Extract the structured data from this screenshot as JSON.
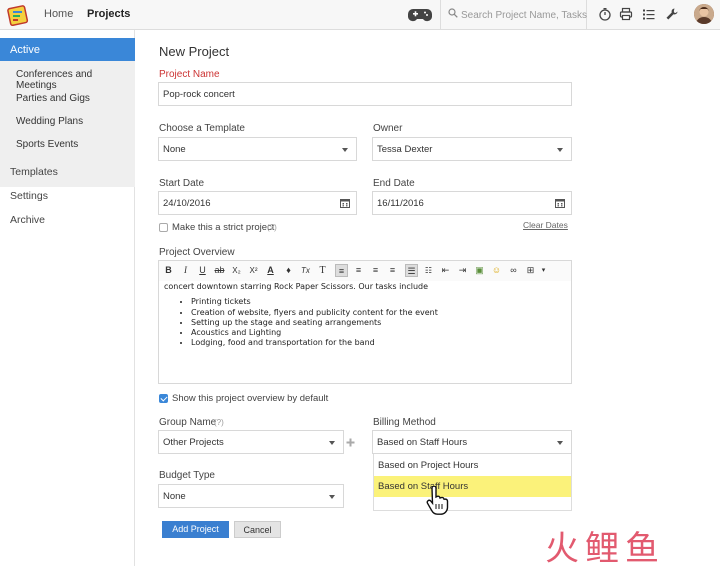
{
  "topbar": {
    "nav": {
      "home": "Home",
      "projects": "Projects"
    },
    "search_placeholder": "Search Project Name, Tasks",
    "icons": [
      "timer-icon",
      "printer-icon",
      "list-icon",
      "wrench-icon"
    ]
  },
  "sidebar": {
    "active": "Active",
    "sub_items": [
      "Conferences and Meetings",
      "Parties and Gigs",
      "Wedding Plans",
      "Sports Events"
    ],
    "items": [
      "Templates",
      "Settings",
      "Archive"
    ]
  },
  "form": {
    "title": "New Project",
    "project_name_label": "Project Name",
    "project_name_value": "Pop-rock concert",
    "template_label": "Choose a Template",
    "template_value": "None",
    "owner_label": "Owner",
    "owner_value": "Tessa Dexter",
    "start_date_label": "Start Date",
    "start_date_value": "24/10/2016",
    "end_date_label": "End Date",
    "end_date_value": "16/11/2016",
    "strict_label": "Make this a strict project",
    "help_mark": "(?)",
    "clear_dates": "Clear Dates",
    "overview_label": "Project Overview",
    "overview_intro": "concert downtown starring Rock Paper Scissors. Our tasks include",
    "overview_items": [
      "Printing tickets",
      "Creation of website, flyers and publicity content for the event",
      "Setting up the stage and seating arrangements",
      "Acoustics and Lighting",
      "Lodging, food and transportation for the band"
    ],
    "show_overview_label": "Show this project overview by default",
    "group_label": "Group Name",
    "group_value": "Other Projects",
    "billing_label": "Billing Method",
    "billing_value": "Based on Staff Hours",
    "billing_options": [
      "Based on Project Hours",
      "Based on Staff Hours"
    ],
    "budget_label": "Budget Type",
    "budget_value": "None",
    "add_button": "Add Project",
    "cancel_button": "Cancel"
  },
  "watermark": "火鲤鱼",
  "colors": {
    "accent": "#3a87d8",
    "required": "#cc3333",
    "highlight": "#fbf27a"
  }
}
